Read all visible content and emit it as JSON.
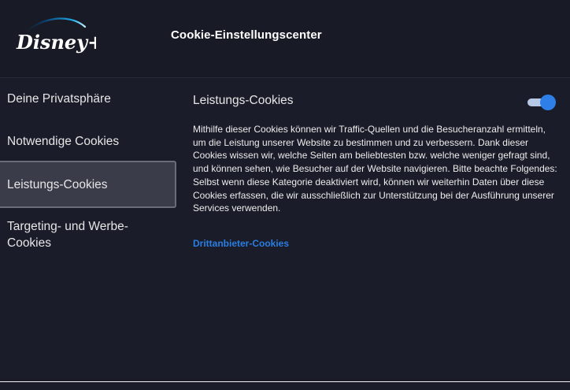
{
  "header": {
    "logo_text": "Disney+",
    "title": "Cookie-Einstellungscenter"
  },
  "sidebar": {
    "items": [
      {
        "label": "Deine Privatsphäre",
        "active": false
      },
      {
        "label": "Notwendige Cookies",
        "active": false
      },
      {
        "label": "Leistungs-Cookies",
        "active": true
      },
      {
        "label": "Targeting- und Werbe-Cookies",
        "active": false
      }
    ]
  },
  "content": {
    "title": "Leistungs-Cookies",
    "toggle_on": true,
    "description": "Mithilfe dieser Cookies können wir Traffic-Quellen und die Besucheranzahl ermitteln, um die Leistung unserer Website zu bestimmen und zu verbessern. Dank dieser Cookies wissen wir, welche Seiten am beliebtesten bzw. welche weniger gefragt sind, und können sehen, wie Besucher auf der Website navigieren. Bitte beachte Folgendes: Selbst wenn diese Kategorie deaktiviert wird, können wir weiterhin Daten über diese Cookies erfassen, die wir ausschließlich zur Unterstützung bei der Ausführung unserer Services verwenden.",
    "link_label": "Drittanbieter-Cookies"
  },
  "colors": {
    "background": "#1a1d29",
    "header_background": "#181b26",
    "active_item_background": "#3a3d49",
    "toggle_knob": "#2f7fe8",
    "link": "#2a7de1"
  }
}
